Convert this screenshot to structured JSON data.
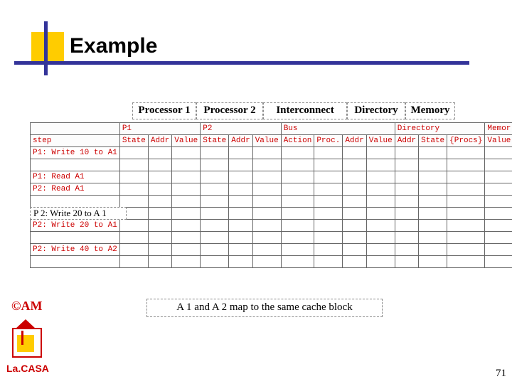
{
  "title": "Example",
  "groups": {
    "g1": "Processor 1",
    "g2": "Processor 2",
    "g3": "Interconnect",
    "g4": "Directory",
    "g5": "Memory"
  },
  "table": {
    "hdr1": {
      "c0": "",
      "c1": "P1",
      "c4": "P2",
      "c7": "Bus",
      "c11": "Directory",
      "c14": "Memor"
    },
    "hdr2": {
      "c0": "step",
      "c1": "State",
      "c2": "Addr",
      "c3": "Value",
      "c4": "State",
      "c5": "Addr",
      "c6": "Value",
      "c7": "Action",
      "c8": "Proc.",
      "c9": "Addr",
      "c10": "Value",
      "c11": "Addr",
      "c12": "State",
      "c13": "{Procs}",
      "c14": "Value"
    },
    "steps": [
      "P1: Write 10 to A1",
      "",
      "P1: Read A1",
      "P2: Read A1",
      "",
      "",
      "P2: Write 20 to A1",
      "",
      "P2: Write 40 to A2",
      ""
    ]
  },
  "overlay_step": "P 2: Write 20 to A 1",
  "note": "A 1 and A 2 map to the same cache block",
  "am": "©AM",
  "lacasa": "La.CASA",
  "pagenum": "71"
}
